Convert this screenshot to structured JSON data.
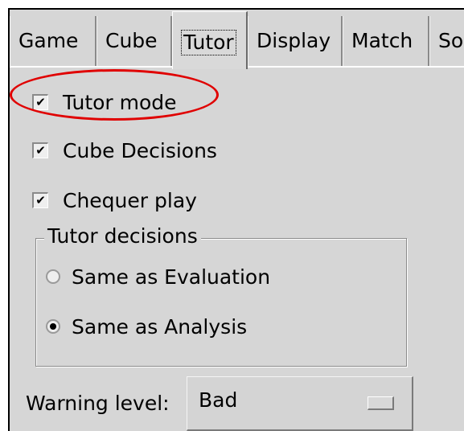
{
  "tabs": [
    {
      "label": "Game"
    },
    {
      "label": "Cube"
    },
    {
      "label": "Tutor",
      "active": true
    },
    {
      "label": "Display"
    },
    {
      "label": "Match"
    },
    {
      "label": "Sou"
    }
  ],
  "options": {
    "tutor_mode": {
      "label": "Tutor mode",
      "checked": true
    },
    "cube_decisions": {
      "label": "Cube Decisions",
      "checked": true
    },
    "chequer_play": {
      "label": "Chequer play",
      "checked": true
    }
  },
  "tutor_decisions": {
    "title": "Tutor decisions",
    "same_as_evaluation": {
      "label": "Same as Evaluation",
      "selected": false
    },
    "same_as_analysis": {
      "label": "Same as Analysis",
      "selected": true
    }
  },
  "warning_level": {
    "label": "Warning level:",
    "value": "Bad"
  },
  "colors": {
    "panel_bg": "#d6d6d6",
    "highlight_ellipse": "#e00000"
  },
  "icons": {
    "check": "✔"
  }
}
